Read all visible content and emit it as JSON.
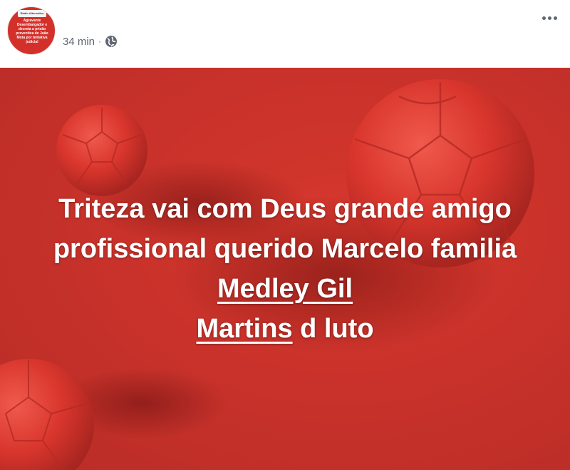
{
  "header": {
    "avatar": {
      "top_label": "Rádio Alternativa",
      "text": "Agravante Desembargador e decreta a prisão preventiva de João Mota por tentativa judicial"
    },
    "timestamp": "34 min",
    "separator": "·",
    "privacy_icon": "globe-icon",
    "more_icon": "more-horizontal-icon"
  },
  "post": {
    "text_before": "Triteza vai com Deus grande amigo profissional querido Marcelo familia ",
    "tag_1": "Medley Gil",
    "tag_2": "Martins",
    "text_after": " d luto",
    "background_color": "#c6312a",
    "ball_icon": "soccer-ball-icon"
  }
}
